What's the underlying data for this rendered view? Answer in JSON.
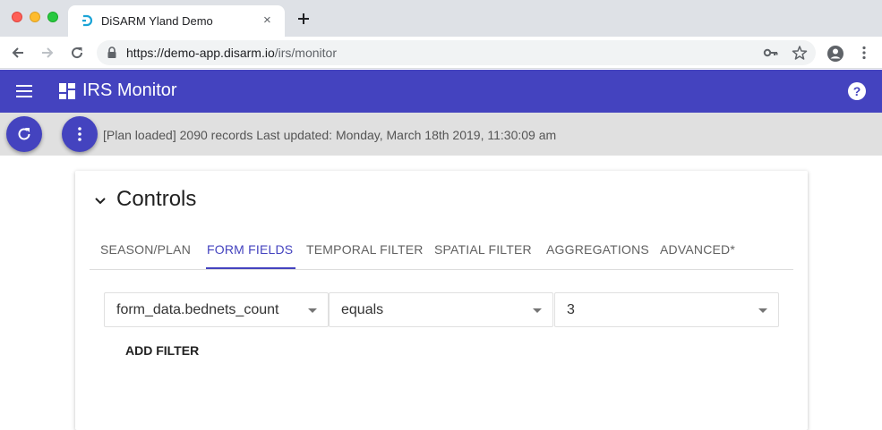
{
  "browser": {
    "tab_title": "DiSARM Yland Demo",
    "tab_close": "×",
    "url_host": "https://demo-app.disarm.io",
    "url_path": "/irs/monitor"
  },
  "appbar": {
    "title": "IRS Monitor",
    "color": "#4443bf"
  },
  "status": {
    "text": "[Plan loaded] 2090 records Last updated: Monday, March 18th 2019, 11:30:09 am"
  },
  "controls": {
    "title": "Controls",
    "tabs": [
      {
        "label": "SEASON/PLAN",
        "active": false
      },
      {
        "label": "FORM FIELDS",
        "active": true
      },
      {
        "label": "TEMPORAL FILTER",
        "active": false
      },
      {
        "label": "SPATIAL FILTER",
        "active": false
      },
      {
        "label": "AGGREGATIONS",
        "active": false
      },
      {
        "label": "ADVANCED*",
        "active": false
      }
    ],
    "filter": {
      "field": "form_data.bednets_count",
      "operator": "equals",
      "value": "3"
    },
    "add_filter_label": "ADD FILTER"
  }
}
